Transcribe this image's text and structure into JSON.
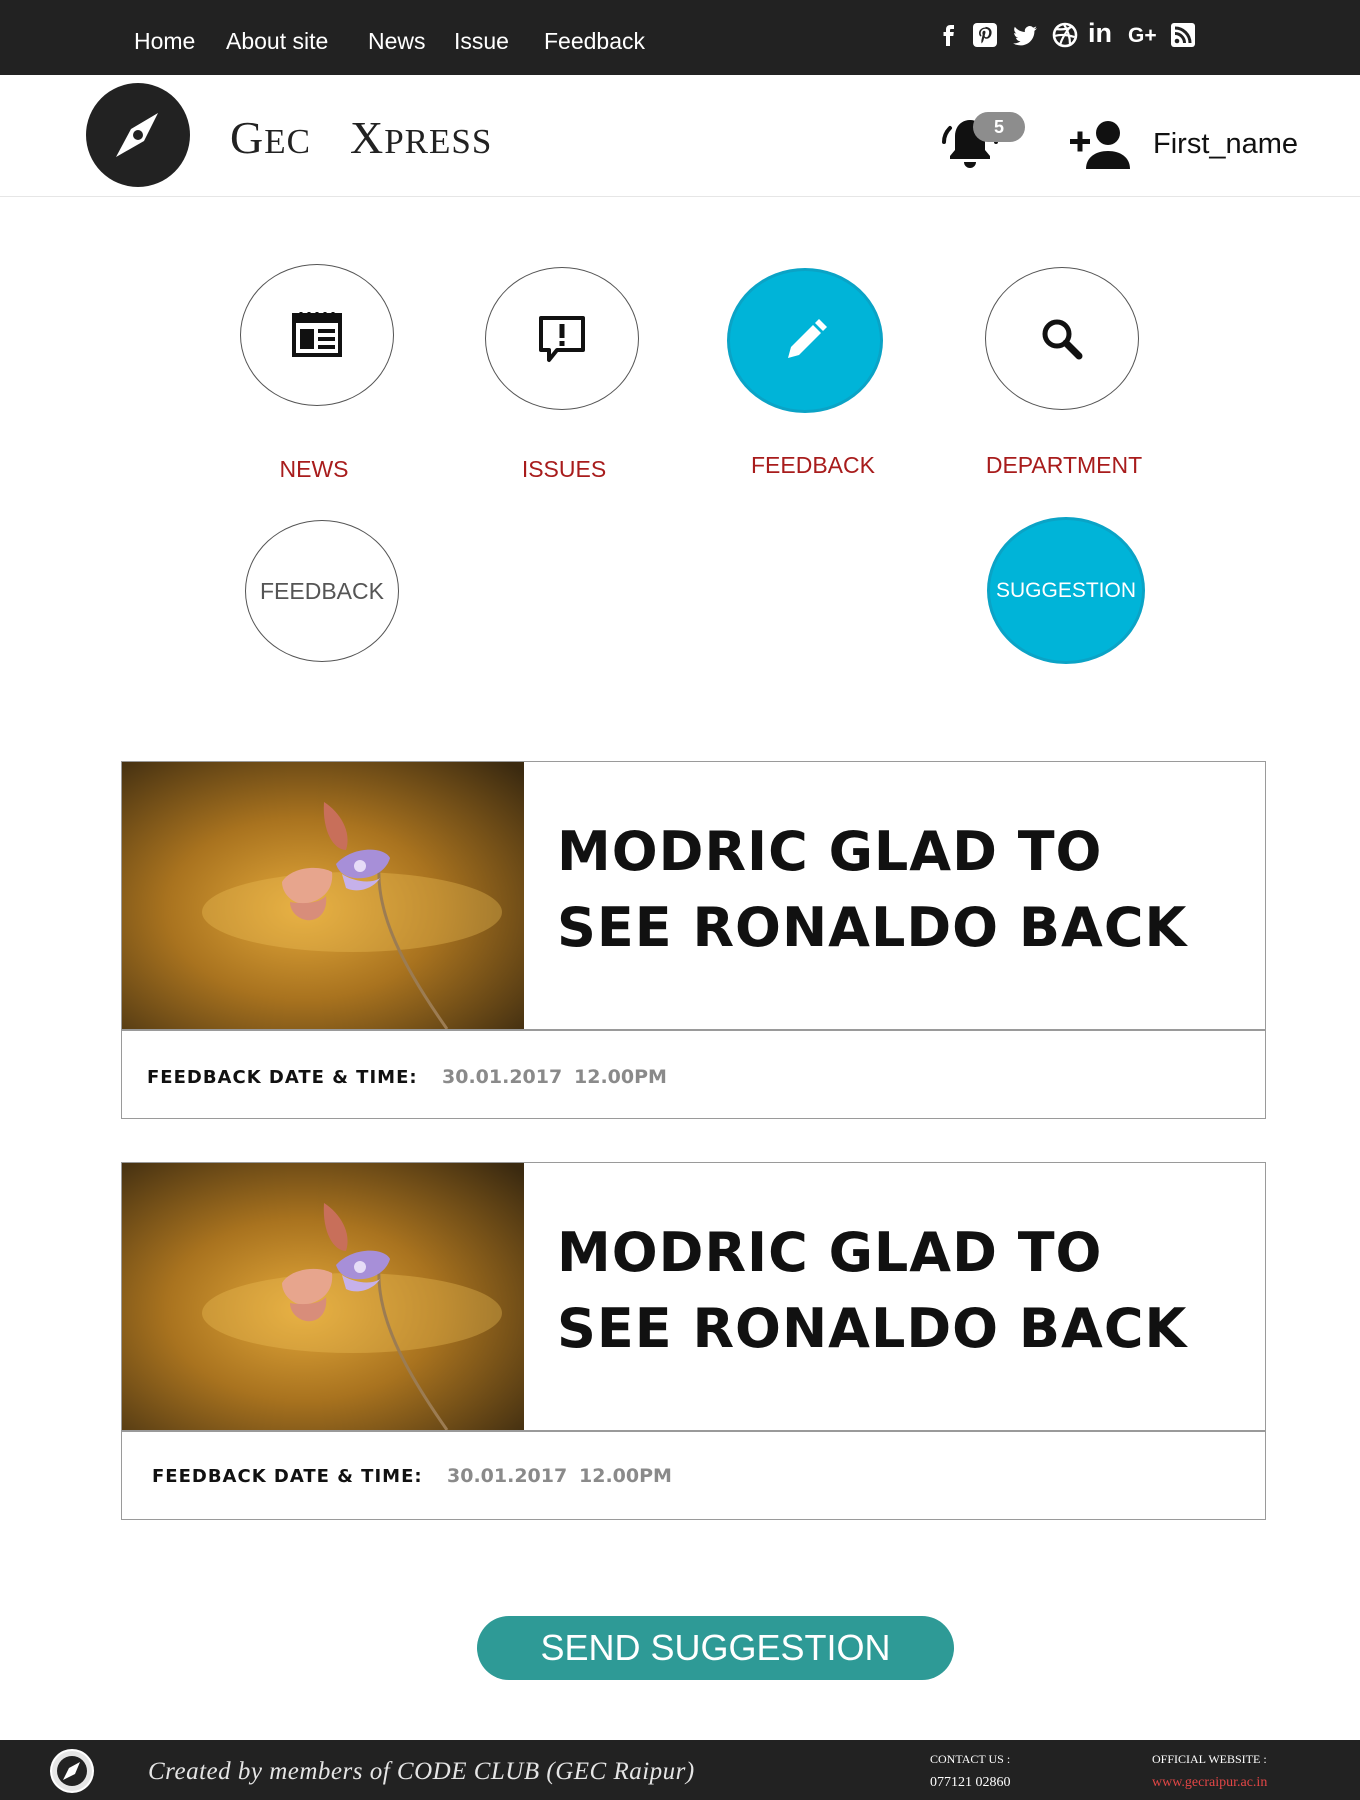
{
  "topnav": {
    "links": [
      "Home",
      "About site",
      "News",
      "Issue",
      "Feedback"
    ],
    "social_icons": [
      "facebook-icon",
      "pinterest-icon",
      "twitter-icon",
      "dribbble-icon",
      "linkedin-icon",
      "google-plus-icon",
      "rss-icon"
    ],
    "social_glyphs": {
      "linkedin": "in",
      "googleplus": "G+"
    }
  },
  "header": {
    "brand_first_initial": "G",
    "brand_first_rest": "EC",
    "brand_second_initial": "X",
    "brand_second_rest": "PRESS",
    "notification_count": "5",
    "username": "First_name"
  },
  "categories": [
    {
      "label": "NEWS",
      "icon": "newspaper-icon",
      "active": false
    },
    {
      "label": "ISSUES",
      "icon": "report-issue-icon",
      "active": false
    },
    {
      "label": "FEEDBACK",
      "icon": "pencil-icon",
      "active": true
    },
    {
      "label": "DEPARTMENT",
      "icon": "search-icon",
      "active": false
    }
  ],
  "filters": {
    "feedback_label": "FEEDBACK",
    "suggestion_label": "SUGGESTION"
  },
  "cards": [
    {
      "title": "MODRIC GLAD TO SEE RONALDO BACK",
      "meta_label": "FEEDBACK DATE & TIME:",
      "date": "30.01.2017",
      "time": "12.00PM"
    },
    {
      "title": "MODRIC GLAD TO SEE RONALDO BACK",
      "meta_label": "FEEDBACK DATE & TIME:",
      "date": "30.01.2017",
      "time": "12.00PM"
    }
  ],
  "send_button_label": "SEND SUGGESTION",
  "footer": {
    "credit": "Created by members of CODE CLUB (GEC Raipur)",
    "contact_label": "CONTACT US :",
    "contact_value": "077121 02860",
    "website_label": "OFFICIAL WEBSITE :",
    "website_value": "www.gecraipur.ac.in"
  },
  "colors": {
    "nav_bg": "#222222",
    "accent_cyan": "#00b4d8",
    "label_red": "#a81c1c",
    "button_teal": "#2e9a96",
    "meta_grey": "#8a8a8a",
    "link_red": "#e34646"
  }
}
